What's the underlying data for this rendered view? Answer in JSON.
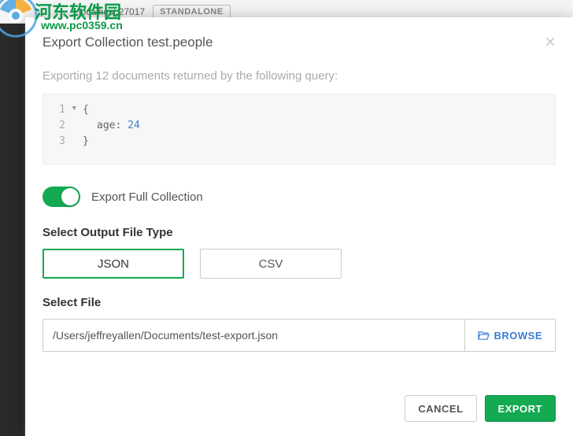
{
  "backdrop": {
    "host": "localhost:27017",
    "mode": "STANDALONE"
  },
  "modal": {
    "title": "Export Collection test.people",
    "query_intro": "Exporting 12 documents returned by the following query:",
    "code": {
      "line1_num": "1",
      "line1_text": "{",
      "line2_num": "2",
      "line2_key": "age:",
      "line2_val": "24",
      "line3_num": "3",
      "line3_text": "}"
    },
    "toggle_label": "Export Full Collection",
    "filetype_label": "Select Output File Type",
    "filetype_json": "JSON",
    "filetype_csv": "CSV",
    "selectfile_label": "Select File",
    "file_path": "/Users/jeffreyallen/Documents/test-export.json",
    "browse_label": "BROWSE",
    "cancel_label": "CANCEL",
    "export_label": "EXPORT"
  },
  "watermark": {
    "line1": "河东软件园",
    "line2": "www.pc0359.cn"
  }
}
